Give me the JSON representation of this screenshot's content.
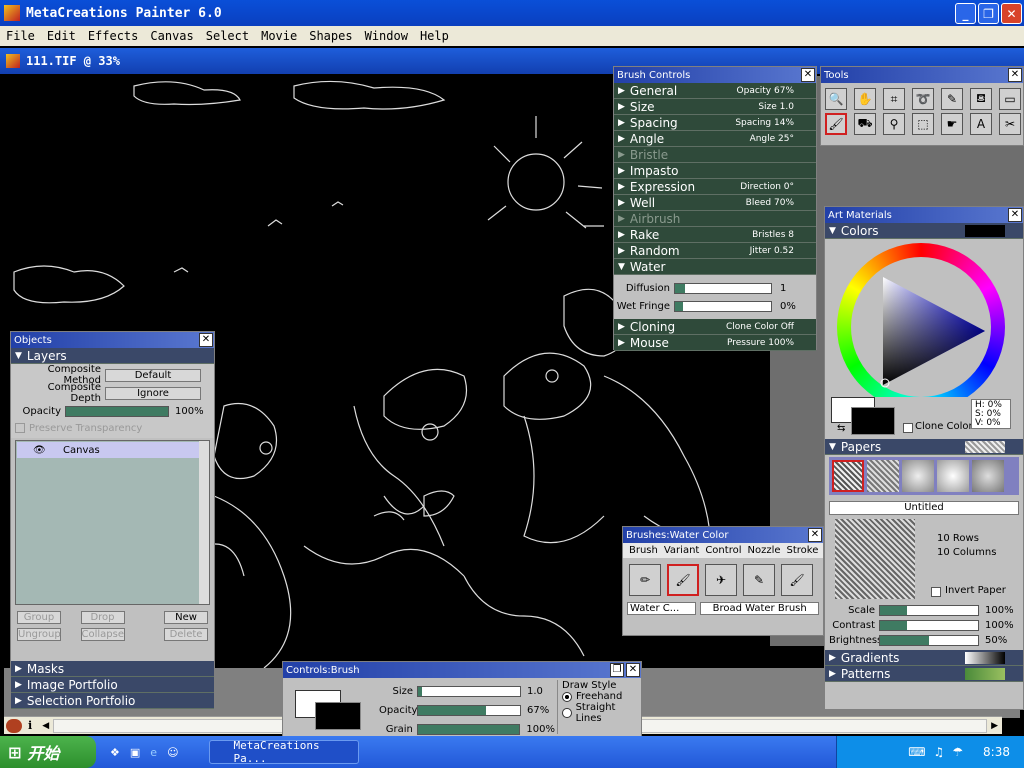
{
  "app": {
    "title": "MetaCreations Painter 6.0"
  },
  "menu": [
    "File",
    "Edit",
    "Effects",
    "Canvas",
    "Select",
    "Movie",
    "Shapes",
    "Window",
    "Help"
  ],
  "document": {
    "title": "111.TIF @ 33%"
  },
  "brush_controls": {
    "title": "Brush Controls",
    "sections": [
      {
        "name": "General",
        "value": "Opacity 67%",
        "enabled": true
      },
      {
        "name": "Size",
        "value": "Size 1.0",
        "enabled": true
      },
      {
        "name": "Spacing",
        "value": "Spacing 14%",
        "enabled": true
      },
      {
        "name": "Angle",
        "value": "Angle 25°",
        "enabled": true
      },
      {
        "name": "Bristle",
        "value": "",
        "enabled": false
      },
      {
        "name": "Impasto",
        "value": "",
        "enabled": true
      },
      {
        "name": "Expression",
        "value": "Direction 0°",
        "enabled": true
      },
      {
        "name": "Well",
        "value": "Bleed 70%",
        "enabled": true
      },
      {
        "name": "Airbrush",
        "value": "",
        "enabled": false
      },
      {
        "name": "Rake",
        "value": "Bristles 8",
        "enabled": true
      },
      {
        "name": "Random",
        "value": "Jitter 0.52",
        "enabled": true
      }
    ],
    "water": {
      "name": "Water",
      "diffusion_label": "Diffusion",
      "diffusion_value": "1",
      "wet_fringe_label": "Wet Fringe",
      "wet_fringe_value": "0%"
    },
    "bottom_sections": [
      {
        "name": "Cloning",
        "value": "Clone Color Off"
      },
      {
        "name": "Mouse",
        "value": "Pressure 100%"
      }
    ]
  },
  "tools": {
    "title": "Tools"
  },
  "objects": {
    "title": "Objects",
    "layers_label": "Layers",
    "composite_method_label": "Composite Method",
    "composite_method_value": "Default",
    "composite_depth_label": "Composite Depth",
    "composite_depth_value": "Ignore",
    "opacity_label": "Opacity",
    "opacity_value": "100%",
    "preserve_label": "Preserve Transparency",
    "layer_name": "Canvas",
    "buttons": {
      "group": "Group",
      "drop": "Drop",
      "new": "New",
      "ungroup": "Ungroup",
      "collapse": "Collapse",
      "delete": "Delete"
    },
    "sections": [
      "Masks",
      "Image Portfolio",
      "Selection Portfolio"
    ]
  },
  "art_materials": {
    "title": "Art Materials",
    "colors_label": "Colors",
    "hsv": {
      "h": "H:  0%",
      "s": "S:  0%",
      "v": "V:  0%"
    },
    "clone_color_label": "Clone Color",
    "papers_label": "Papers",
    "paper_name": "Untitled",
    "rows": "10 Rows",
    "columns": "10 Columns",
    "invert_label": "Invert Paper",
    "scale_label": "Scale",
    "scale_value": "100%",
    "contrast_label": "Contrast",
    "contrast_value": "100%",
    "brightness_label": "Brightness",
    "brightness_value": "50%",
    "gradients_label": "Gradients",
    "patterns_label": "Patterns"
  },
  "brushes": {
    "title": "Brushes:Water Color",
    "menu": [
      "Brush",
      "Variant",
      "Control",
      "Nozzle",
      "Stroke"
    ],
    "category": "Water C...",
    "variant": "Broad Water Brush"
  },
  "controls_brush": {
    "title": "Controls:Brush",
    "size_label": "Size",
    "size_value": "1.0",
    "opacity_label": "Opacity",
    "opacity_value": "67%",
    "grain_label": "Grain",
    "grain_value": "100%",
    "draw_style_label": "Draw Style",
    "freehand_label": "Freehand",
    "straight_label": "Straight Lines"
  },
  "taskbar": {
    "start_label": "开始",
    "task_label": "MetaCreations Pa...",
    "time": "8:38"
  },
  "colors": {
    "titlebar": "#0a4fd8",
    "palette_section": "#2f4a3a",
    "slider_fill": "#3f7b62",
    "canvas": "#000000"
  }
}
